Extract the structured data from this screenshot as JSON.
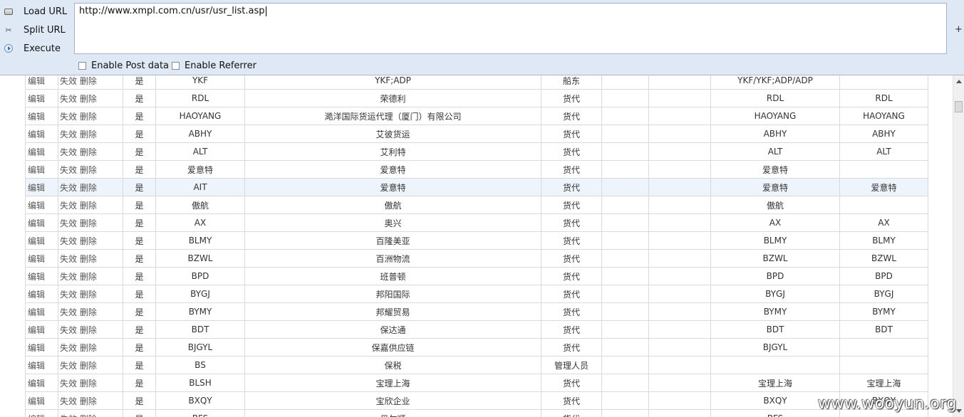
{
  "hackbar": {
    "load_url": "Load URL",
    "split_url": "Split URL",
    "execute": "Execute",
    "url_value": "http://www.xmpl.com.cn/usr/usr_list.asp",
    "enable_post": "Enable Post data",
    "enable_referrer": "Enable Referrer",
    "plus": "+"
  },
  "table": {
    "rows": [
      {
        "edit": "编辑",
        "ops": "失效 删除",
        "flag": "是",
        "code": "YKF",
        "name": "YKF;ADP",
        "type": "船东",
        "e1": "",
        "e2": "",
        "alias": "YKF/YKF;ADP/ADP",
        "short": ""
      },
      {
        "edit": "编辑",
        "ops": "失效 删除",
        "flag": "是",
        "code": "RDL",
        "name": "荣德利",
        "type": "货代",
        "e1": "",
        "e2": "",
        "alias": "RDL",
        "short": "RDL"
      },
      {
        "edit": "编辑",
        "ops": "失效 删除",
        "flag": "是",
        "code": "HAOYANG",
        "name": "澔洋国际货运代理（厦门）有限公司",
        "type": "货代",
        "e1": "",
        "e2": "",
        "alias": "HAOYANG",
        "short": "HAOYANG"
      },
      {
        "edit": "编辑",
        "ops": "失效 删除",
        "flag": "是",
        "code": "ABHY",
        "name": "艾彼货运",
        "type": "货代",
        "e1": "",
        "e2": "",
        "alias": "ABHY",
        "short": "ABHY"
      },
      {
        "edit": "编辑",
        "ops": "失效 删除",
        "flag": "是",
        "code": "ALT",
        "name": "艾利特",
        "type": "货代",
        "e1": "",
        "e2": "",
        "alias": "ALT",
        "short": "ALT"
      },
      {
        "edit": "编辑",
        "ops": "失效 删除",
        "flag": "是",
        "code": "爱意特",
        "name": "爱意特",
        "type": "货代",
        "e1": "",
        "e2": "",
        "alias": "爱意特",
        "short": ""
      },
      {
        "edit": "编辑",
        "ops": "失效 删除",
        "flag": "是",
        "code": "AIT",
        "name": "爱意特",
        "type": "货代",
        "e1": "",
        "e2": "",
        "alias": "爱意特",
        "short": "爱意特"
      },
      {
        "edit": "编辑",
        "ops": "失效 删除",
        "flag": "是",
        "code": "傲航",
        "name": "傲航",
        "type": "货代",
        "e1": "",
        "e2": "",
        "alias": "傲航",
        "short": ""
      },
      {
        "edit": "编辑",
        "ops": "失效 删除",
        "flag": "是",
        "code": "AX",
        "name": "奥兴",
        "type": "货代",
        "e1": "",
        "e2": "",
        "alias": "AX",
        "short": "AX"
      },
      {
        "edit": "编辑",
        "ops": "失效 删除",
        "flag": "是",
        "code": "BLMY",
        "name": "百隆美亚",
        "type": "货代",
        "e1": "",
        "e2": "",
        "alias": "BLMY",
        "short": "BLMY"
      },
      {
        "edit": "编辑",
        "ops": "失效 删除",
        "flag": "是",
        "code": "BZWL",
        "name": "百洲物流",
        "type": "货代",
        "e1": "",
        "e2": "",
        "alias": "BZWL",
        "short": "BZWL"
      },
      {
        "edit": "编辑",
        "ops": "失效 删除",
        "flag": "是",
        "code": "BPD",
        "name": "班普顿",
        "type": "货代",
        "e1": "",
        "e2": "",
        "alias": "BPD",
        "short": "BPD"
      },
      {
        "edit": "编辑",
        "ops": "失效 删除",
        "flag": "是",
        "code": "BYGJ",
        "name": "邦阳国际",
        "type": "货代",
        "e1": "",
        "e2": "",
        "alias": "BYGJ",
        "short": "BYGJ"
      },
      {
        "edit": "编辑",
        "ops": "失效 删除",
        "flag": "是",
        "code": "BYMY",
        "name": "邦耀贸易",
        "type": "货代",
        "e1": "",
        "e2": "",
        "alias": "BYMY",
        "short": "BYMY"
      },
      {
        "edit": "编辑",
        "ops": "失效 删除",
        "flag": "是",
        "code": "BDT",
        "name": "保达通",
        "type": "货代",
        "e1": "",
        "e2": "",
        "alias": "BDT",
        "short": "BDT"
      },
      {
        "edit": "编辑",
        "ops": "失效 删除",
        "flag": "是",
        "code": "BJGYL",
        "name": "保嘉供应链",
        "type": "货代",
        "e1": "",
        "e2": "",
        "alias": "BJGYL",
        "short": ""
      },
      {
        "edit": "编辑",
        "ops": "失效 删除",
        "flag": "是",
        "code": "BS",
        "name": "保税",
        "type": "管理人员",
        "e1": "",
        "e2": "",
        "alias": "",
        "short": ""
      },
      {
        "edit": "编辑",
        "ops": "失效 删除",
        "flag": "是",
        "code": "BLSH",
        "name": "宝理上海",
        "type": "货代",
        "e1": "",
        "e2": "",
        "alias": "宝理上海",
        "short": "宝理上海"
      },
      {
        "edit": "编辑",
        "ops": "失效 删除",
        "flag": "是",
        "code": "BXQY",
        "name": "宝欣企业",
        "type": "货代",
        "e1": "",
        "e2": "",
        "alias": "BXQY",
        "short": "BXQY"
      },
      {
        "edit": "编辑",
        "ops": "失效 删除",
        "flag": "是",
        "code": "BFS",
        "name": "贝尔顺",
        "type": "货代",
        "e1": "",
        "e2": "",
        "alias": "BFS",
        "short": ""
      }
    ],
    "highlight_row": 6
  },
  "watermark": "www.wooyun.org"
}
